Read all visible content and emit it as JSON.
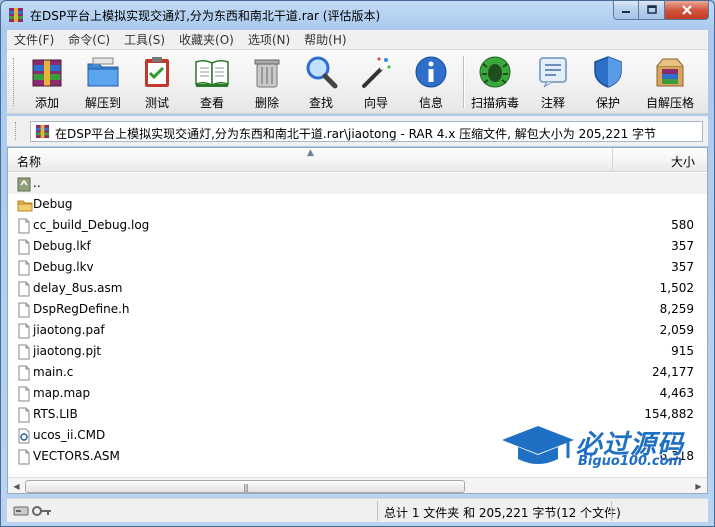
{
  "window": {
    "title": "在DSP平台上模拟实现交通灯,分为东西和南北干道.rar (评估版本)"
  },
  "menu": [
    "文件(F)",
    "命令(C)",
    "工具(S)",
    "收藏夹(O)",
    "选项(N)",
    "帮助(H)"
  ],
  "toolbar": {
    "add": "添加",
    "extract": "解压到",
    "test": "测试",
    "view": "查看",
    "delete": "删除",
    "find": "查找",
    "wizard": "向导",
    "info": "信息",
    "scan": "扫描病毒",
    "comment": "注释",
    "protect": "保护",
    "sfx": "自解压格"
  },
  "address": {
    "path": "在DSP平台上模拟实现交通灯,分为东西和南北干道.rar\\jiaotong - RAR 4.x 压缩文件, 解包大小为 205,221 字节"
  },
  "columns": {
    "name": "名称",
    "size": "大小"
  },
  "files": [
    {
      "name": "..",
      "size": "",
      "icon": "up-folder-icon"
    },
    {
      "name": "Debug",
      "size": "",
      "icon": "folder-icon"
    },
    {
      "name": "cc_build_Debug.log",
      "size": "580",
      "icon": "file-icon"
    },
    {
      "name": "Debug.lkf",
      "size": "357",
      "icon": "file-icon"
    },
    {
      "name": "Debug.lkv",
      "size": "357",
      "icon": "file-icon"
    },
    {
      "name": "delay_8us.asm",
      "size": "1,502",
      "icon": "file-icon"
    },
    {
      "name": "DspRegDefine.h",
      "size": "8,259",
      "icon": "file-icon"
    },
    {
      "name": "jiaotong.paf",
      "size": "2,059",
      "icon": "file-icon"
    },
    {
      "name": "jiaotong.pjt",
      "size": "915",
      "icon": "file-icon"
    },
    {
      "name": "main.c",
      "size": "24,177",
      "icon": "file-icon"
    },
    {
      "name": "map.map",
      "size": "4,463",
      "icon": "file-icon"
    },
    {
      "name": "RTS.LIB",
      "size": "154,882",
      "icon": "file-icon"
    },
    {
      "name": "ucos_ii.CMD",
      "size": "",
      "icon": "cmd-file-icon"
    },
    {
      "name": "VECTORS.ASM",
      "size": "6,318",
      "icon": "file-icon"
    }
  ],
  "status": {
    "summary": "总计 1 文件夹 和 205,221 字节(12 个文件)"
  },
  "watermark": {
    "main": "必过源码",
    "sub": "Biguo100.com"
  }
}
